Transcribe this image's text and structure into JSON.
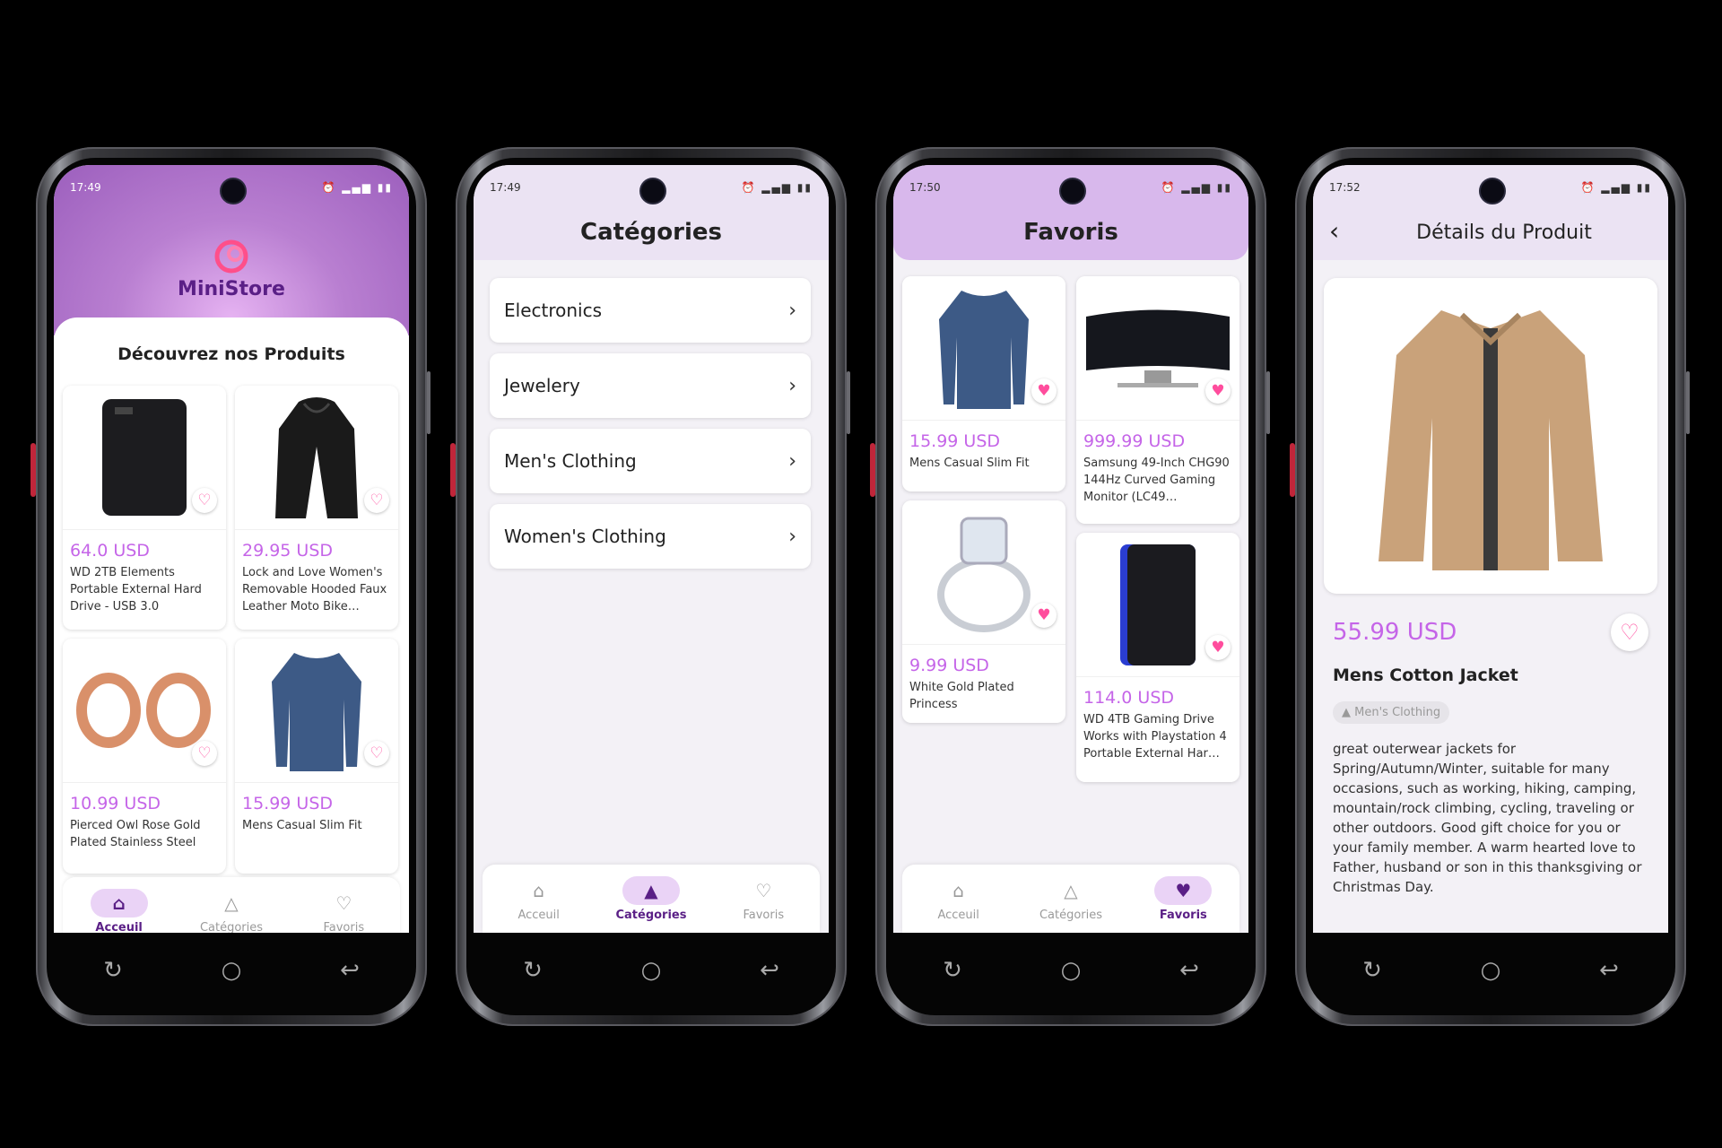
{
  "phones": {
    "home": {
      "time": "17:49",
      "brand": "MiniStore",
      "section_title": "Découvrez nos Produits",
      "products": [
        {
          "price": "64.0 USD",
          "name": "WD 2TB Elements Portable External Hard Drive - USB 3.0"
        },
        {
          "price": "29.95 USD",
          "name": "Lock and Love Women's Removable Hooded Faux Leather Moto Bike…"
        },
        {
          "price": "10.99 USD",
          "name": "Pierced Owl Rose Gold Plated Stainless Steel"
        },
        {
          "price": "15.99 USD",
          "name": "Mens Casual Slim Fit"
        }
      ]
    },
    "categories": {
      "time": "17:49",
      "title": "Catégories",
      "items": [
        "Electronics",
        "Jewelery",
        "Men's Clothing",
        "Women's Clothing"
      ]
    },
    "favoris": {
      "time": "17:50",
      "title": "Favoris",
      "products": [
        {
          "price": "15.99 USD",
          "name": "Mens Casual Slim Fit"
        },
        {
          "price": "999.99 USD",
          "name": "Samsung 49-Inch CHG90 144Hz Curved Gaming Monitor (LC49…"
        },
        {
          "price": "9.99 USD",
          "name": "White Gold Plated Princess"
        },
        {
          "price": "114.0 USD",
          "name": "WD 4TB Gaming Drive Works with Playstation 4 Portable External Har…"
        }
      ]
    },
    "details": {
      "time": "17:52",
      "title": "Détails du Produit",
      "price": "55.99 USD",
      "name": "Mens Cotton Jacket",
      "category": "Men's Clothing",
      "description": "great outerwear jackets for Spring/Autumn/Winter, suitable for many occasions, such as working, hiking, camping, mountain/rock climbing, cycling, traveling or other outdoors. Good gift choice for you or your family member. A warm hearted love to Father, husband or son in this thanksgiving or Christmas Day."
    }
  },
  "tabs": {
    "home": "Acceuil",
    "categories": "Catégories",
    "favoris": "Favoris"
  },
  "colors": {
    "accent": "#c565e8",
    "primary": "#5a1f86",
    "heart": "#ff5fa8"
  }
}
